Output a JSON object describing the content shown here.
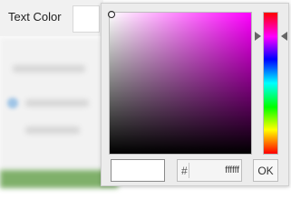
{
  "field": {
    "label": "Text Color",
    "color": "#ffffff"
  },
  "picker": {
    "hue_color": "#ff00ff",
    "hex_prefix": "#",
    "hex_value": "ffffff",
    "ok_label": "OK",
    "preview_color": "#ffffff"
  }
}
